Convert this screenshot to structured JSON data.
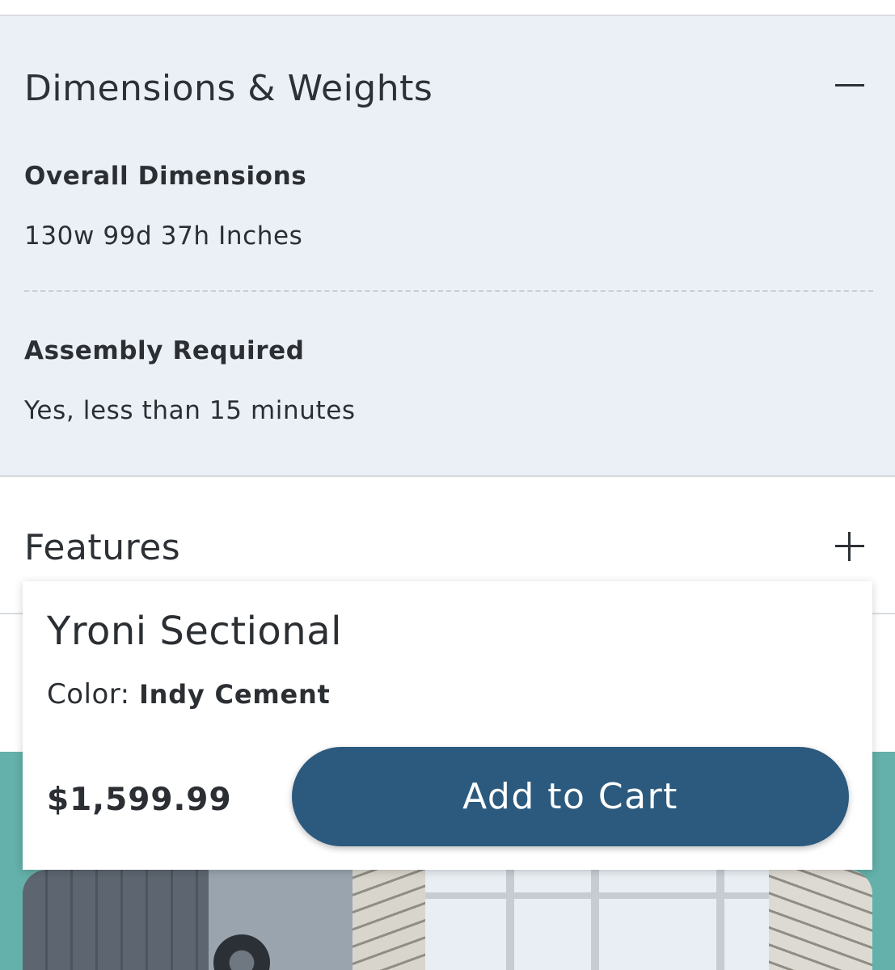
{
  "dimensions_section": {
    "title": "Dimensions & Weights",
    "toggle_icon": "minus-icon",
    "specs": [
      {
        "label": "Overall Dimensions",
        "value": "130w 99d 37h Inches"
      },
      {
        "label": "Assembly Required",
        "value": "Yes, less than 15 minutes"
      }
    ]
  },
  "features_section": {
    "title": "Features",
    "toggle_icon": "plus-icon"
  },
  "sticky_bar": {
    "product_name": "Yroni Sectional",
    "color_label": "Color:",
    "color_value": "Indy Cement",
    "price": "$1,599.99",
    "add_to_cart_label": "Add to Cart",
    "button_color": "#2c5a7e"
  },
  "promo": {
    "background_color": "#64b0aa"
  }
}
